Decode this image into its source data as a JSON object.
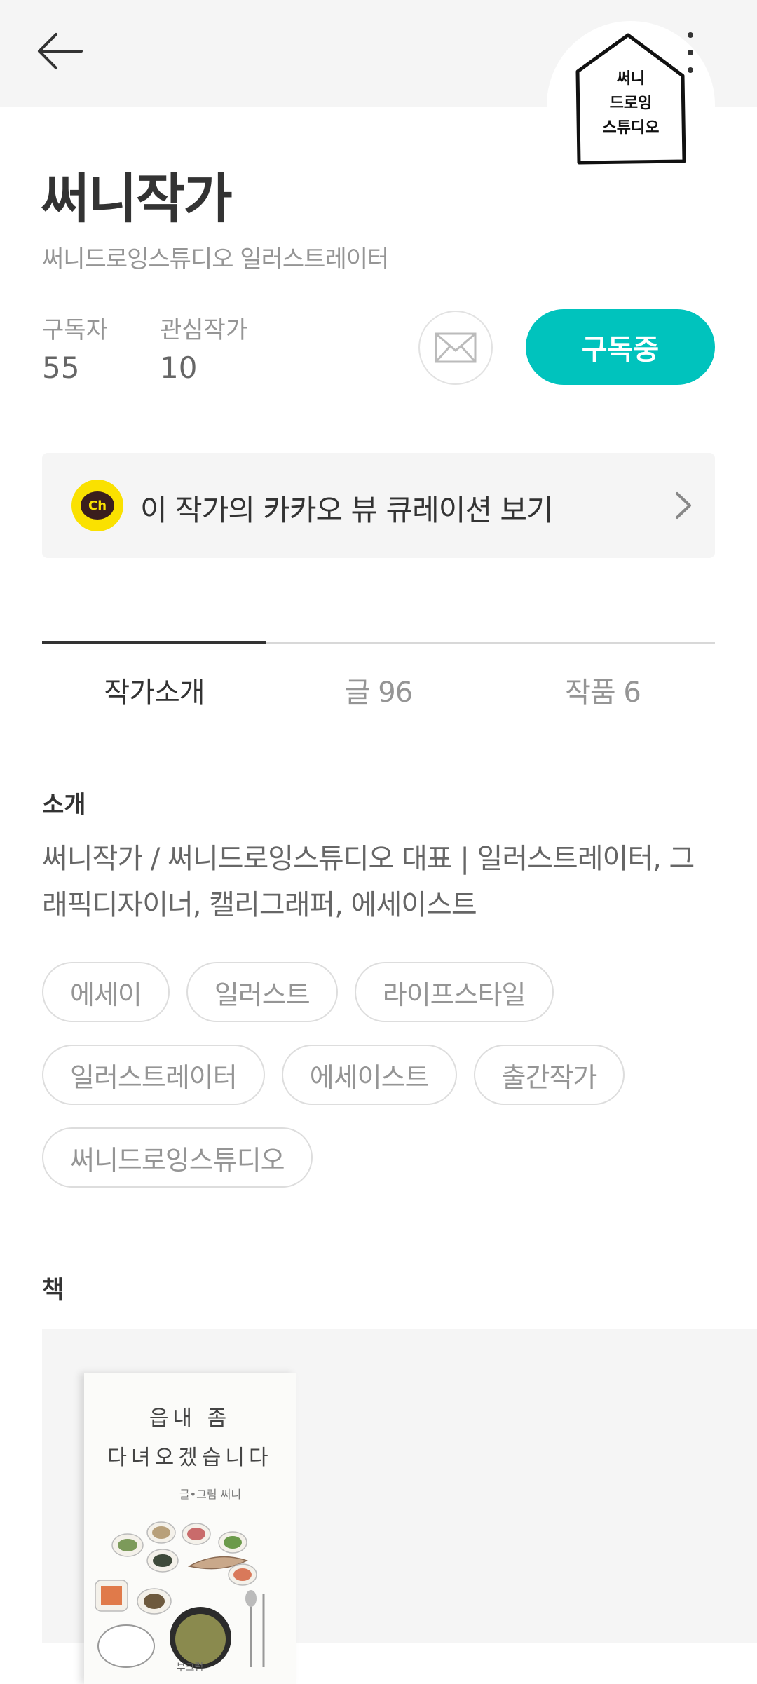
{
  "profile": {
    "avatar_text": "써니\n드로잉\n스튜디오",
    "name": "써니작가",
    "role": "써니드로잉스튜디오 일러스트레이터"
  },
  "stats": {
    "subscribers_label": "구독자",
    "subscribers_value": "55",
    "interests_label": "관심작가",
    "interests_value": "10"
  },
  "actions": {
    "subscribe_label": "구독중"
  },
  "kakao": {
    "logo_text": "Ch",
    "banner_text": "이 작가의 카카오 뷰 큐레이션 보기"
  },
  "tabs": [
    {
      "label": "작가소개",
      "active": true
    },
    {
      "label": "글 96",
      "active": false
    },
    {
      "label": "작품 6",
      "active": false
    }
  ],
  "intro": {
    "title": "소개",
    "text": "써니작가 / 써니드로잉스튜디오 대표 | 일러스트레이터, 그래픽디자이너, 캘리그래퍼, 에세이스트"
  },
  "tags": [
    "에세이",
    "일러스트",
    "라이프스타일",
    "일러스트레이터",
    "에세이스트",
    "출간작가",
    "써니드로잉스튜디오"
  ],
  "books": {
    "title": "책",
    "items": [
      {
        "cover_title": "읍내 좀\n다녀오겠습니다",
        "cover_author": "글•그림 써니",
        "cover_publisher": "부크럼"
      }
    ]
  },
  "colors": {
    "accent": "#00c3bd",
    "kakao_yellow": "#fae100",
    "top_band": "#f5f5f5"
  },
  "icons": {
    "back": "arrow-left-icon",
    "more": "more-vertical-icon",
    "mail": "mail-icon",
    "chevron": "chevron-right-icon"
  }
}
